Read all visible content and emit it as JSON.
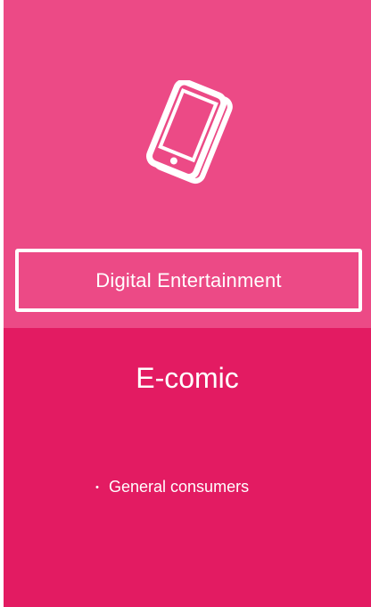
{
  "card": {
    "category": "Digital Entertainment",
    "icon": "smartphone-icon",
    "product": "E-comic",
    "targets": [
      {
        "bullet": "・",
        "label": "General consumers"
      }
    ],
    "colors": {
      "top": "#EC4A86",
      "bottom": "#E31B62",
      "foreground": "#FFFFFF"
    }
  }
}
